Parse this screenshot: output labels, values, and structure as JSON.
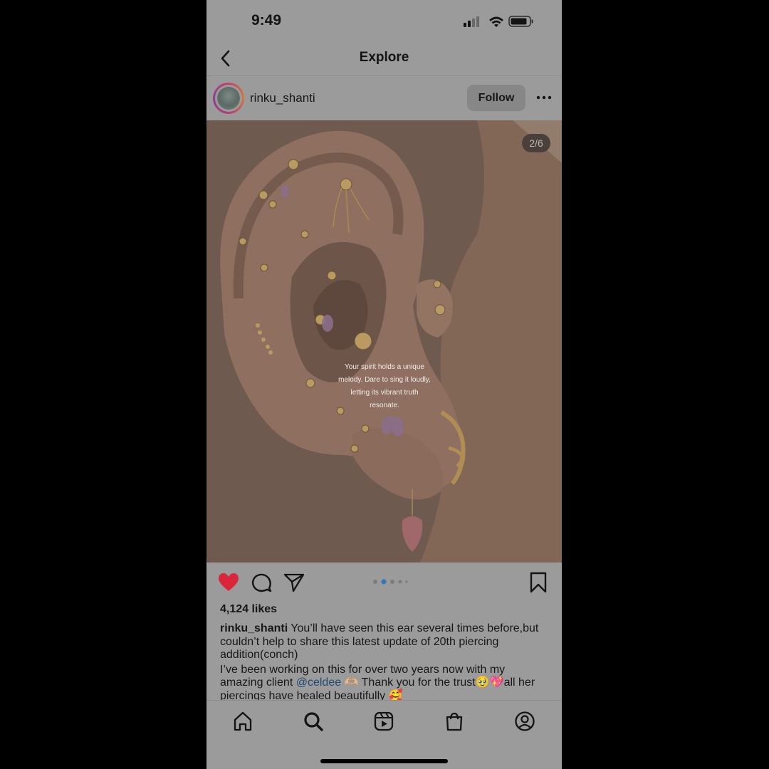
{
  "status": {
    "time": "9:49"
  },
  "nav": {
    "title": "Explore"
  },
  "post": {
    "username": "rinku_shanti",
    "follow_label": "Follow",
    "counter": "2/6",
    "overlay_text": "Your spirit holds a unique melody. Dare to sing it loudly, letting its vibrant truth resonate.",
    "likes": "4,124 likes",
    "caption_user": "rinku_shanti",
    "caption_line1": "You’ll have seen this ear several times before,but couldn’t help to share this latest update of 20th piercing addition(conch)",
    "caption_line2_a": "I’ve been working on this for over two years now with my amazing client",
    "caption_mention": "@celdee",
    "caption_line2_b": "🫶🏼 Thank you for the trust🥹💖all her piercings have healed beautifully 🥰",
    "carousel": {
      "total": 6,
      "current": 2
    }
  },
  "icons": {
    "back": "chevron-left-icon",
    "more": "ellipsis-icon",
    "like": "heart-icon",
    "comment": "comment-icon",
    "share": "send-icon",
    "save": "bookmark-icon",
    "tabs": [
      "home-icon",
      "search-icon",
      "reels-icon",
      "shop-icon",
      "profile-icon"
    ]
  },
  "colors": {
    "like_red": "#d9263a",
    "mention_blue": "#1f4a73",
    "dot_active": "#2f78b5"
  }
}
